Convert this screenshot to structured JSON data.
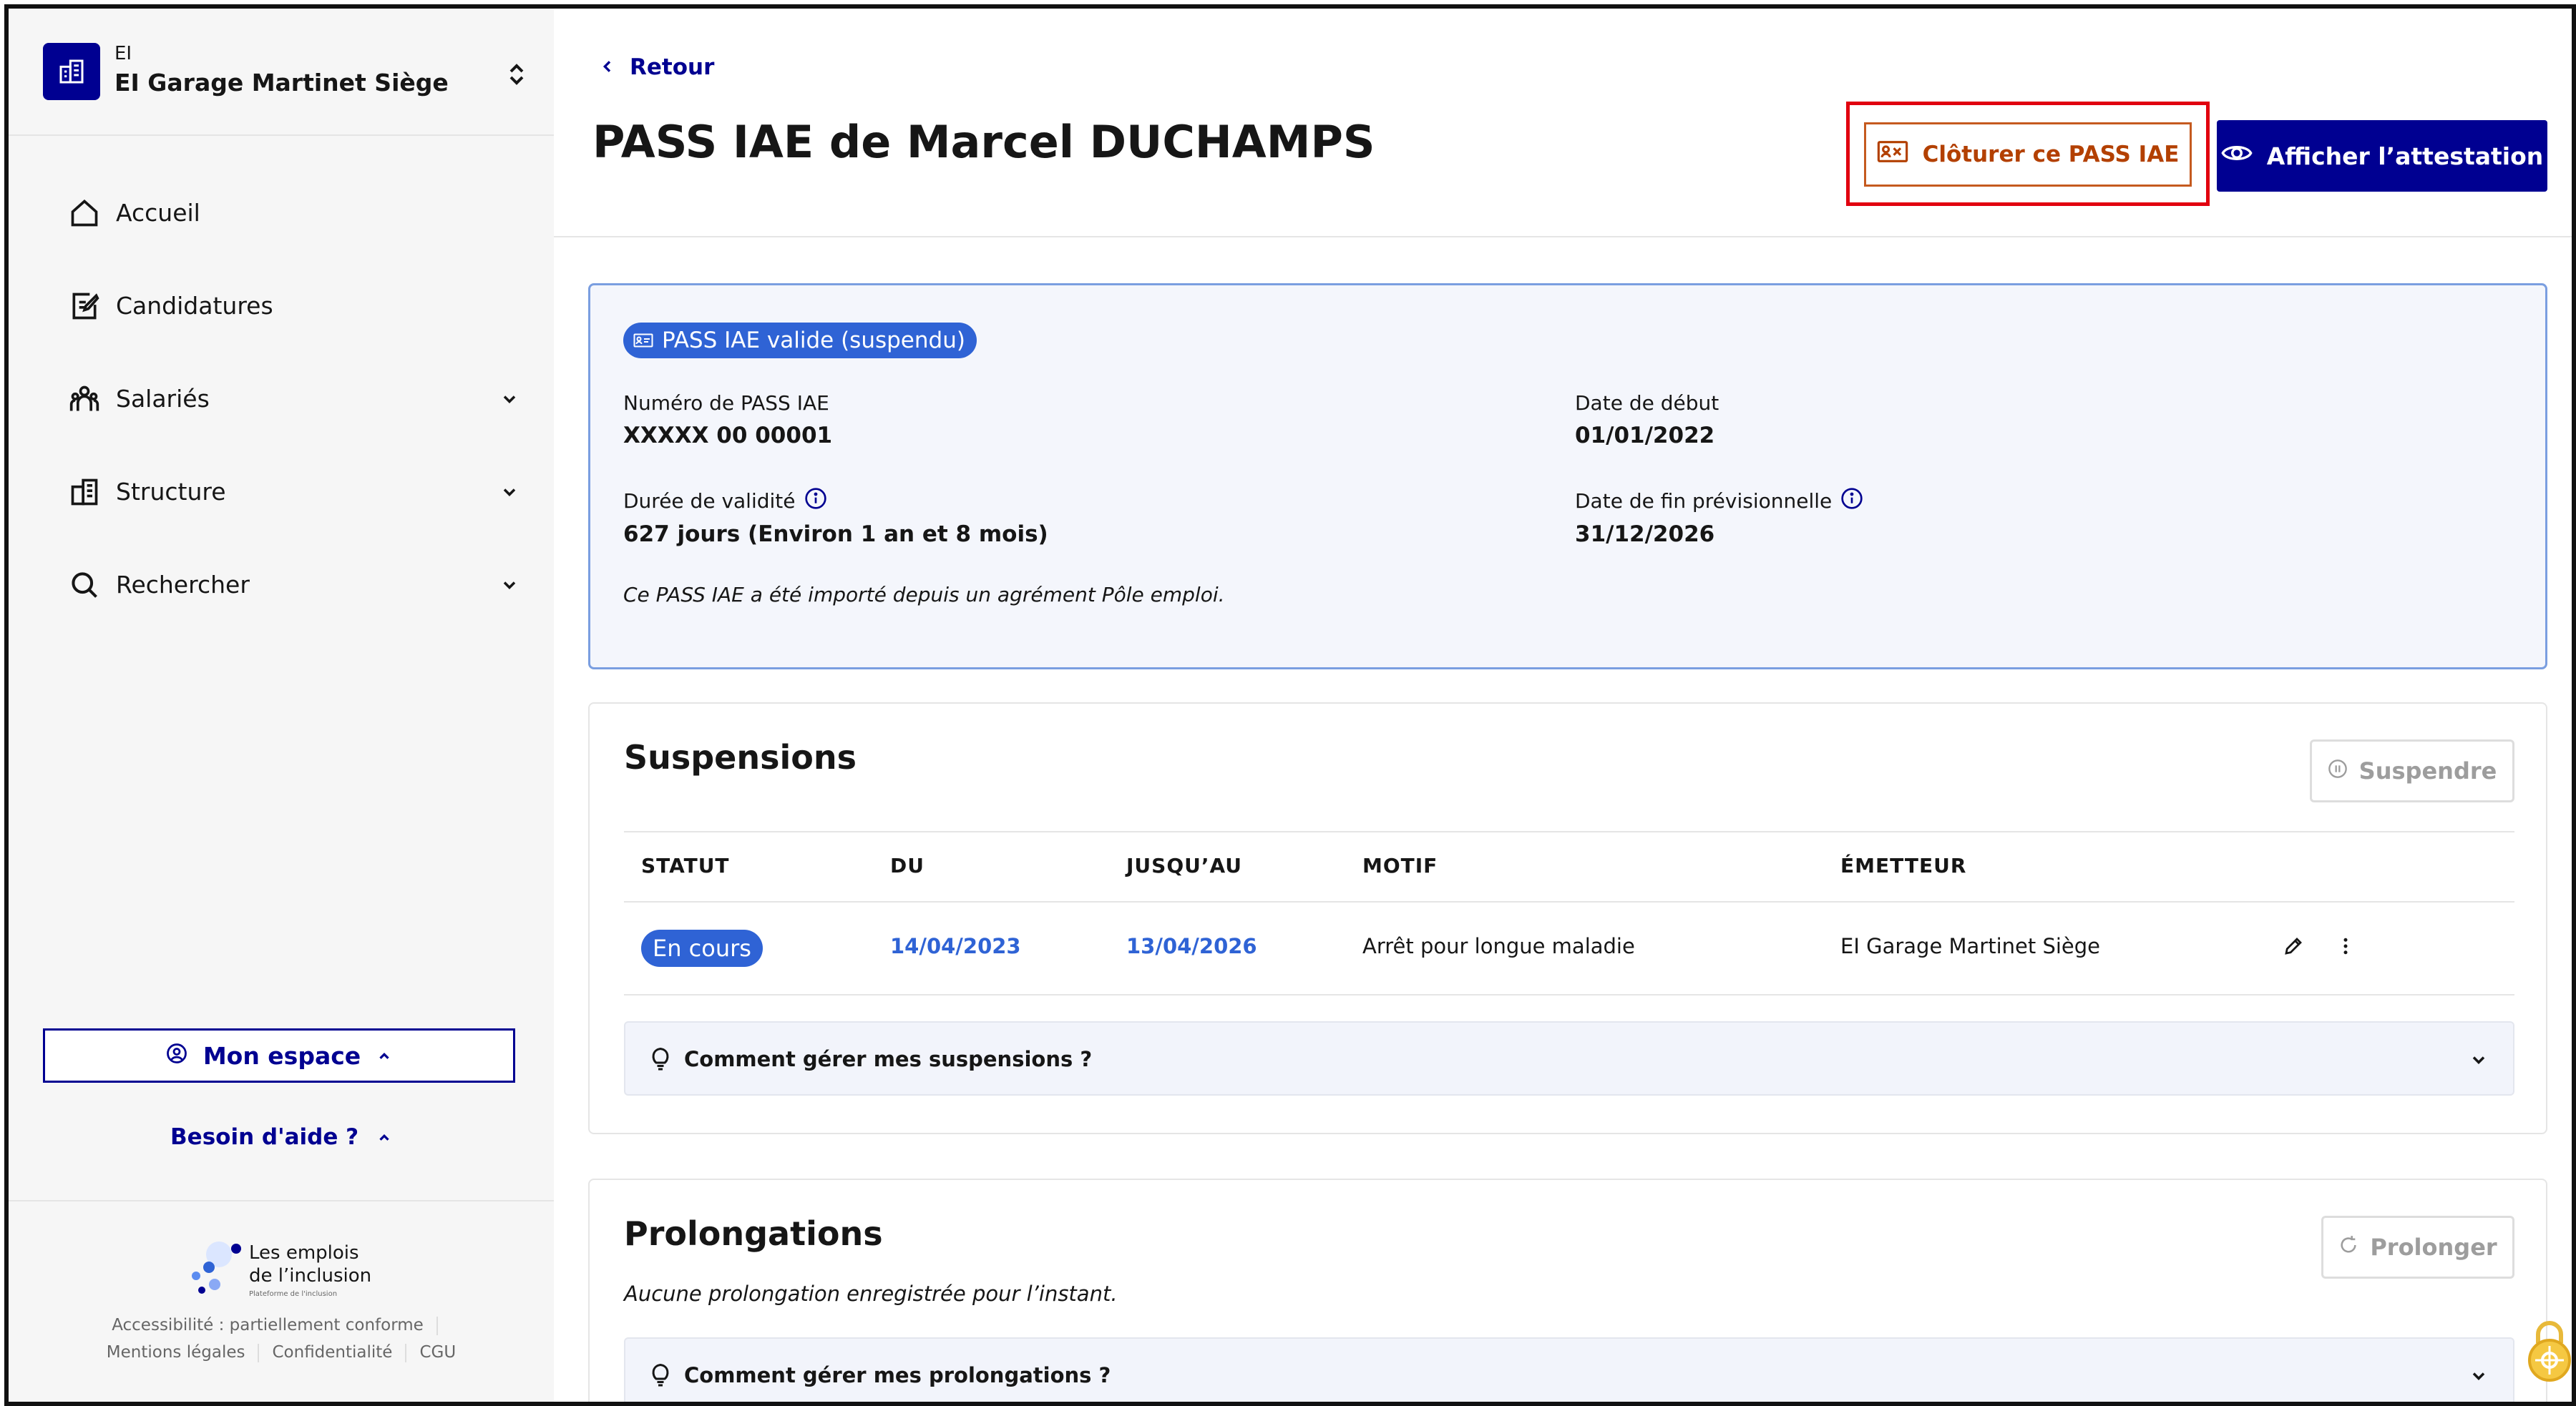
{
  "sidebar": {
    "org_type": "EI",
    "org_name": "EI Garage Martinet Siège",
    "nav": [
      {
        "label": "Accueil",
        "icon": "home-icon"
      },
      {
        "label": "Candidatures",
        "icon": "edit-document-icon"
      },
      {
        "label": "Salariés",
        "icon": "team-icon"
      },
      {
        "label": "Structure",
        "icon": "building-icon"
      },
      {
        "label": "Rechercher",
        "icon": "search-icon"
      }
    ],
    "mon_espace": "Mon espace",
    "besoin_aide": "Besoin d'aide ?",
    "footer": {
      "logo_line1": "Les emplois",
      "logo_line2": "de l’inclusion",
      "logo_sub": "Plateforme de l'inclusion",
      "accessibility": "Accessibilité : partiellement conforme",
      "links": [
        "Mentions légales",
        "Confidentialité",
        "CGU"
      ]
    }
  },
  "header": {
    "back_label": "Retour",
    "title": "PASS IAE de Marcel DUCHAMPS",
    "close_button": "Clôturer ce PASS IAE",
    "attestation_button": "Afficher l’attestation"
  },
  "pass": {
    "badge": "PASS IAE valide (suspendu)",
    "numero_label": "Numéro de PASS IAE",
    "numero_value": "XXXXX 00 00001",
    "debut_label": "Date de début",
    "debut_value": "01/01/2022",
    "duree_label": "Durée de validité",
    "duree_value": "627 jours (Environ 1 an et 8 mois)",
    "fin_label": "Date de fin prévisionnelle",
    "fin_value": "31/12/2026",
    "note": "Ce PASS IAE a été importé depuis un agrément Pôle emploi."
  },
  "suspensions": {
    "title": "Suspensions",
    "button": "Suspendre",
    "columns": [
      "STATUT",
      "DU",
      "JUSQU’AU",
      "MOTIF",
      "ÉMETTEUR"
    ],
    "rows": [
      {
        "statut": "En cours",
        "du": "14/04/2023",
        "jusqu": "13/04/2026",
        "motif": "Arrêt pour longue maladie",
        "emetteur": "EI Garage Martinet Siège"
      }
    ],
    "help": "Comment gérer mes suspensions ?"
  },
  "prolongations": {
    "title": "Prolongations",
    "button": "Prolonger",
    "empty": "Aucune prolongation enregistrée pour l’instant.",
    "help": "Comment gérer mes prolongations ?"
  }
}
